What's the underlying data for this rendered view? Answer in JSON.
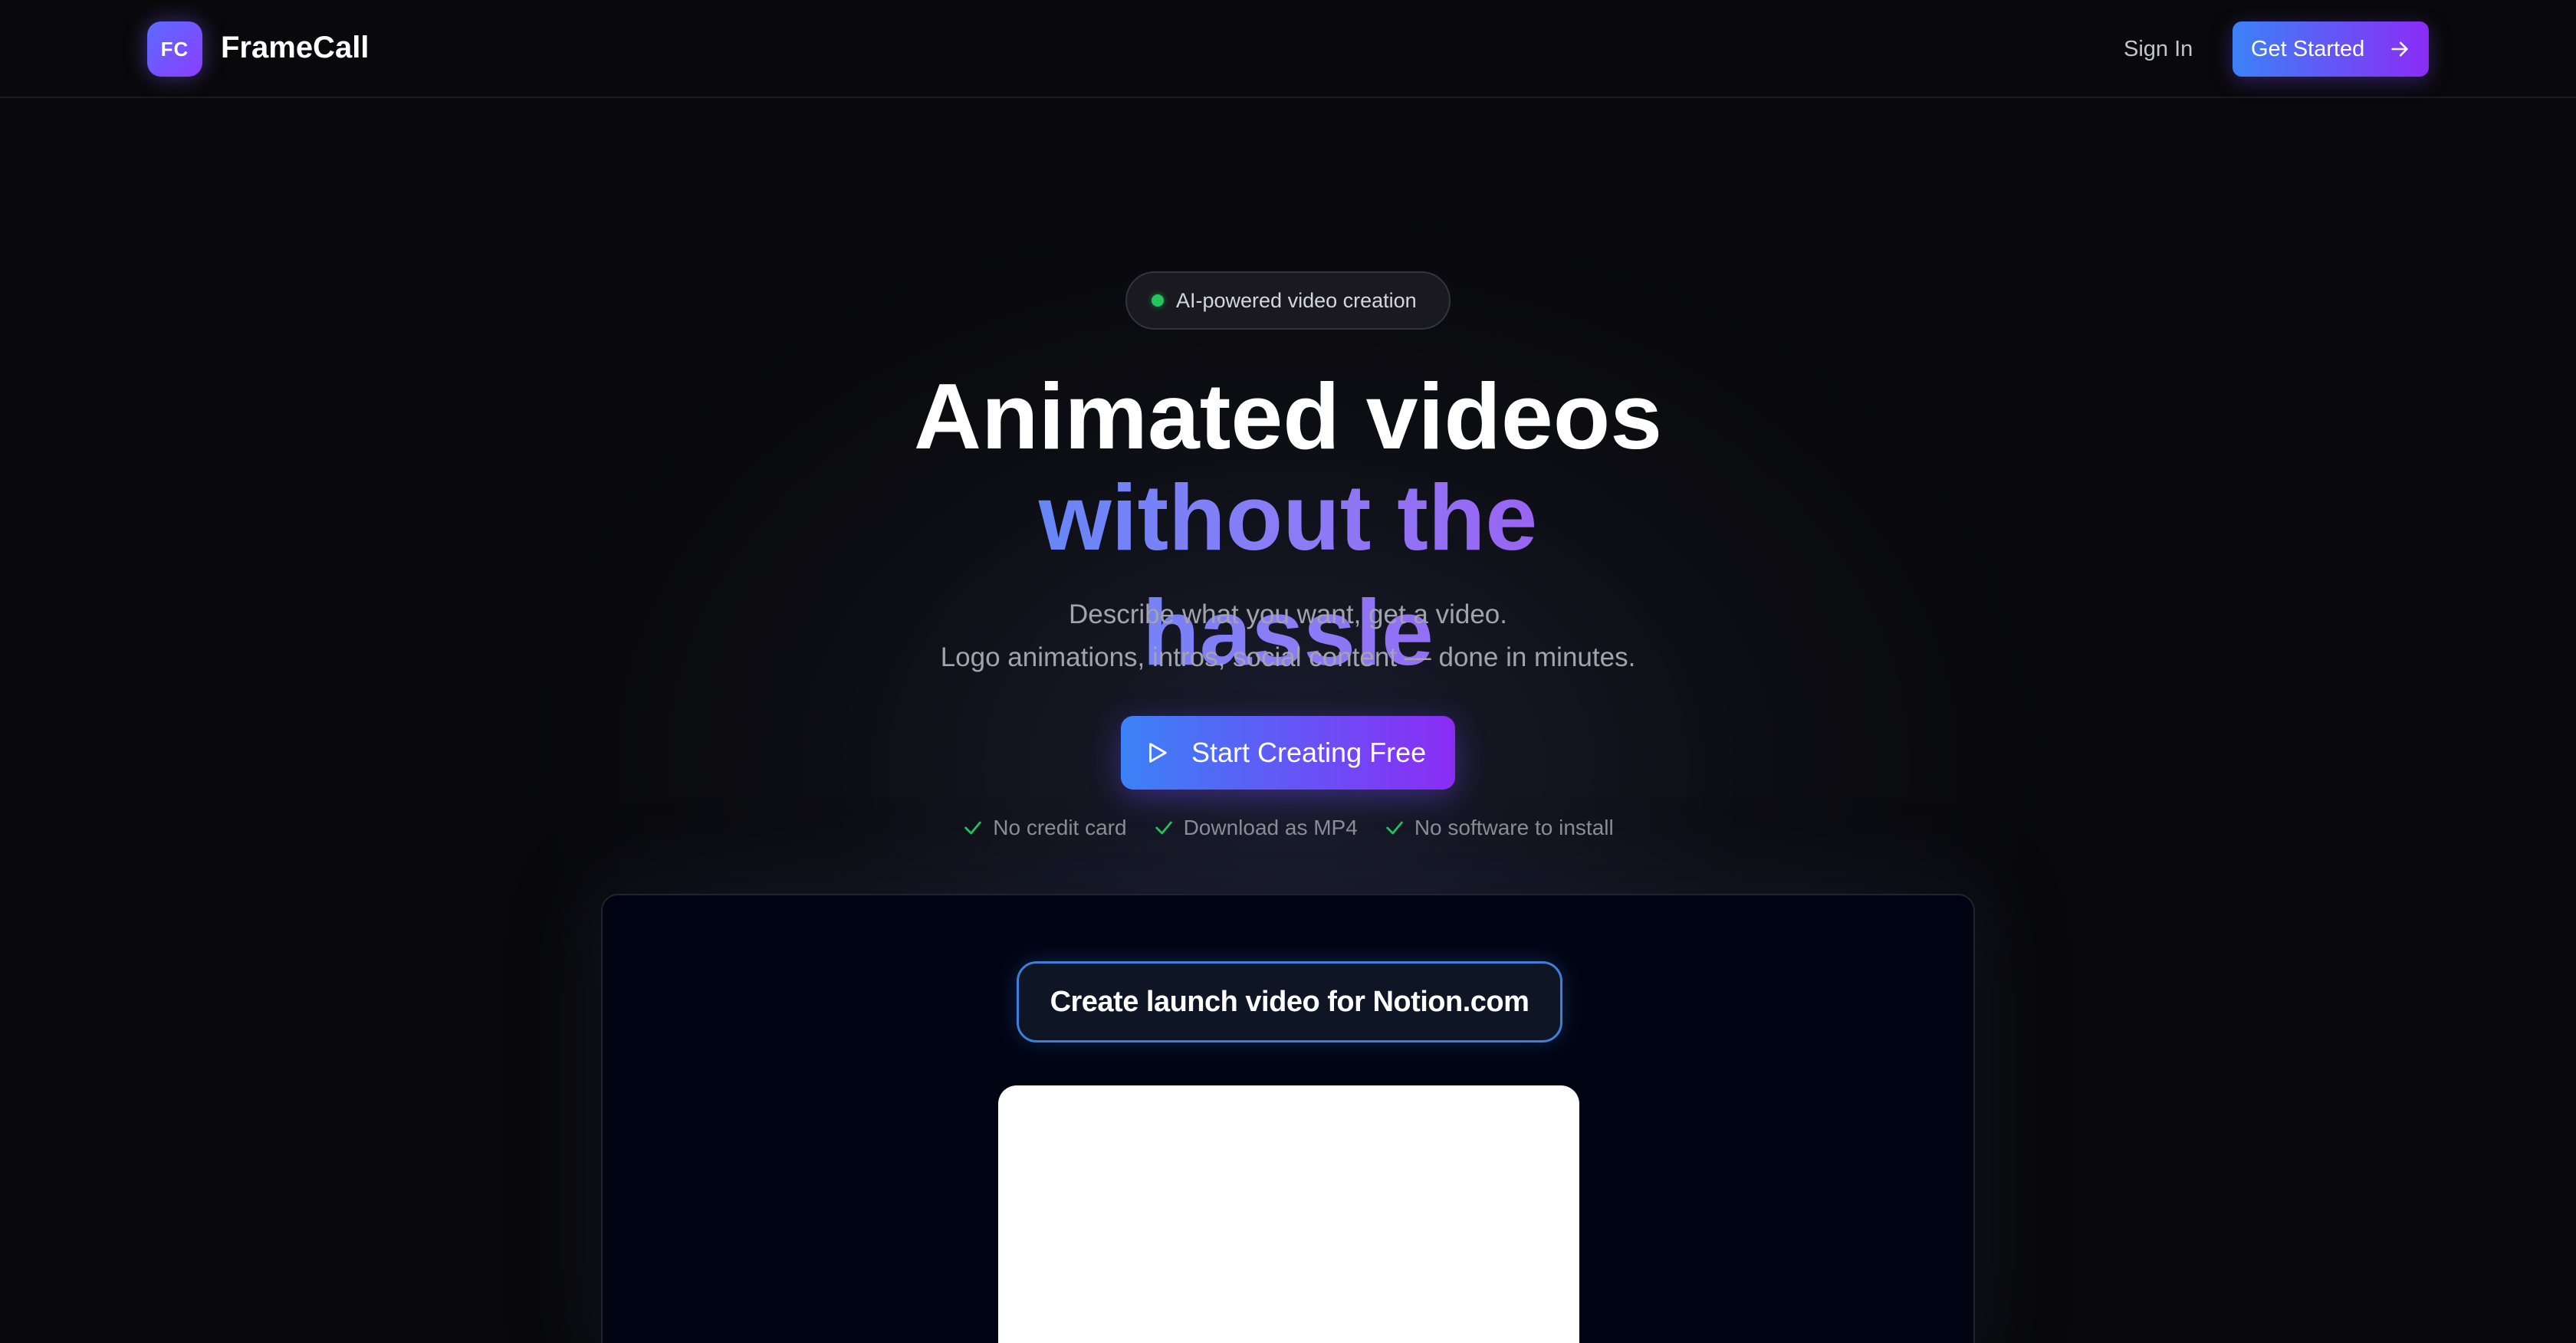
{
  "header": {
    "logo_initials": "FC",
    "brand_name": "FrameCall",
    "signin_label": "Sign In",
    "get_started_label": "Get Started"
  },
  "hero": {
    "badge_text": "AI-powered video creation",
    "headline_line1": "Animated videos",
    "headline_line2": "without the hassle",
    "subtitle_line1": "Describe what you want, get a video.",
    "subtitle_line2": "Logo animations, intros, social content — done in minutes.",
    "cta_label": "Start Creating Free",
    "features": [
      "No credit card",
      "Download as MP4",
      "No software to install"
    ]
  },
  "preview": {
    "prompt_text": "Create launch video for Notion.com"
  },
  "colors": {
    "background": "#09090b",
    "accent_start": "#3b82f6",
    "accent_end": "#8b2cf5",
    "status_dot": "#22c55e",
    "check": "#22c55e"
  },
  "icons": {
    "cta": "play-icon",
    "header_button": "arrow-right-icon",
    "feature": "check-icon",
    "badge": "status-dot-icon"
  }
}
